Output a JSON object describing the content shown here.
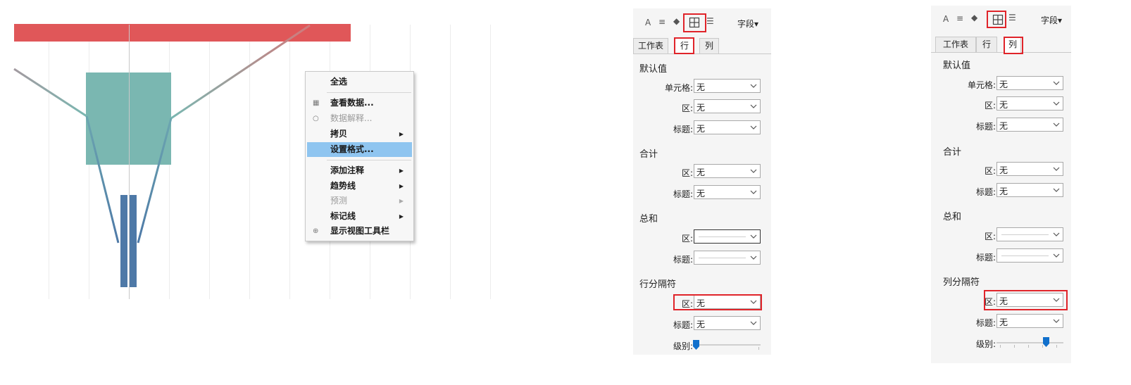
{
  "context_menu": {
    "items": [
      {
        "label": "全选"
      },
      {
        "label": "查看数据..."
      },
      {
        "label": "数据解释..."
      },
      {
        "label": "拷贝"
      },
      {
        "label": "设置格式..."
      },
      {
        "label": "添加注释"
      },
      {
        "label": "趋势线"
      },
      {
        "label": "预测"
      },
      {
        "label": "标记线"
      },
      {
        "label": "显示视图工具栏"
      }
    ],
    "selected": "设置格式..."
  },
  "panel_rows": {
    "toolbar": {
      "font_icon": "A",
      "field_label": "字段▾"
    },
    "tabs": [
      "工作表",
      "行",
      "列"
    ],
    "active_tab": "行",
    "sections": {
      "default": "默认值",
      "subtotal": "合计",
      "grand_total": "总和",
      "divider": "行分隔符"
    },
    "labels": {
      "cell": "单元格:",
      "pane": "区:",
      "header": "标题:",
      "level": "级别:"
    },
    "values": {
      "none": "无"
    }
  },
  "panel_cols": {
    "toolbar": {
      "font_icon": "A",
      "field_label": "字段▾"
    },
    "tabs": [
      "工作表",
      "行",
      "列"
    ],
    "active_tab": "列",
    "sections": {
      "default": "默认值",
      "subtotal": "合计",
      "grand_total": "总和",
      "divider": "列分隔符"
    },
    "labels": {
      "cell": "单元格:",
      "pane": "区:",
      "header": "标题:",
      "level": "级别:"
    },
    "values": {
      "none": "无"
    }
  },
  "colors": {
    "red_bar": "#e05759",
    "teal": "#7ab7b1",
    "blue": "#4e79a7",
    "highlight": "#e0242a",
    "menu_selected": "#8fc5f0"
  }
}
